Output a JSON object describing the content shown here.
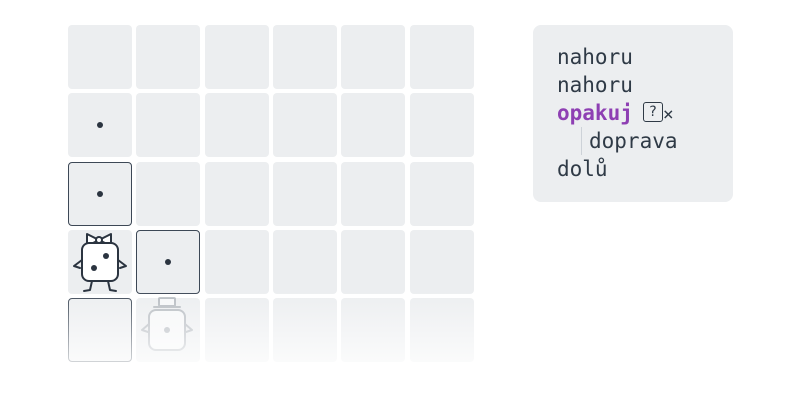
{
  "grid": {
    "cols": 6,
    "rows": 5,
    "dots": [
      [
        1,
        0
      ],
      [
        2,
        0
      ],
      [
        3,
        1
      ]
    ],
    "visited": [
      [
        2,
        0
      ],
      [
        3,
        1
      ],
      [
        4,
        0
      ]
    ],
    "character": {
      "row": 3,
      "col": 0,
      "label": "robot-with-bow"
    },
    "ghost": {
      "row": 4,
      "col": 1,
      "label": "robot-with-hat"
    }
  },
  "program": {
    "lines": [
      {
        "text": "nahoru"
      },
      {
        "text": "nahoru"
      },
      {
        "keyword": "opakuj",
        "count": "?",
        "times": "×"
      },
      {
        "text": "doprava",
        "indent": true
      },
      {
        "text": "dolů"
      }
    ]
  },
  "colors": {
    "cell": "#eceef0",
    "border": "#3d4856",
    "keyword": "#8e3fb3",
    "text": "#2f3a46"
  }
}
